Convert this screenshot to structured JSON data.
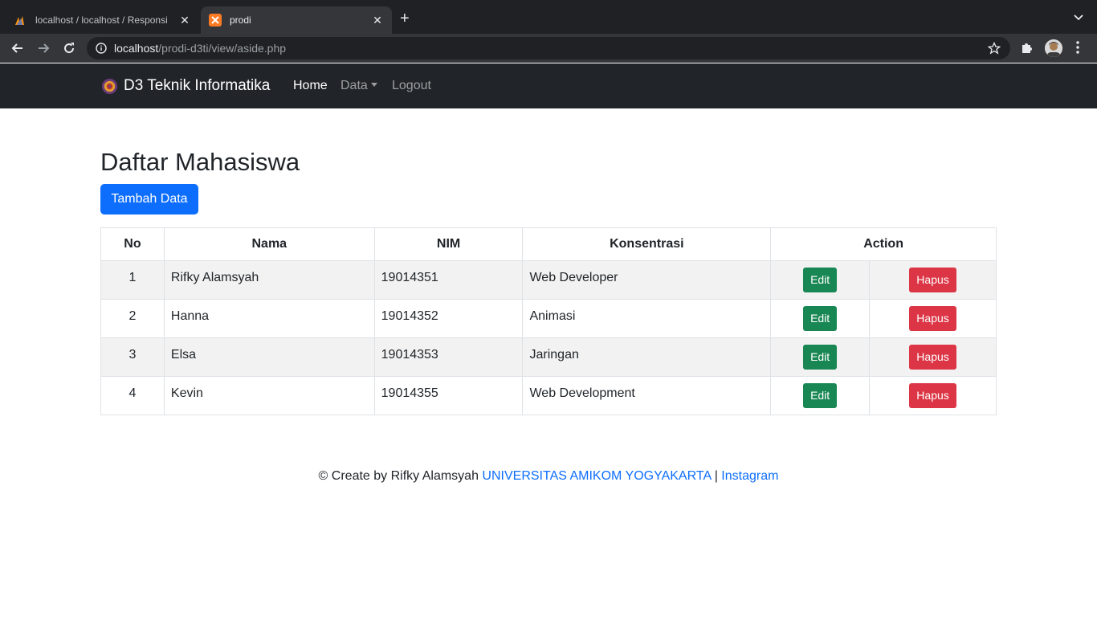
{
  "browser": {
    "tabs": [
      {
        "title": "localhost / localhost / Responsi",
        "active": false
      },
      {
        "title": "prodi",
        "active": true
      }
    ],
    "url_host": "localhost",
    "url_path": "/prodi-d3ti/view/aside.php"
  },
  "navbar": {
    "brand": "D3 Teknik Informatika",
    "links": {
      "home": "Home",
      "data": "Data",
      "logout": "Logout"
    }
  },
  "page": {
    "title": "Daftar Mahasiswa",
    "add_button": "Tambah Data"
  },
  "table": {
    "headers": {
      "no": "No",
      "nama": "Nama",
      "nim": "NIM",
      "konsentrasi": "Konsentrasi",
      "action": "Action"
    },
    "edit_label": "Edit",
    "delete_label": "Hapus",
    "rows": [
      {
        "no": "1",
        "nama": "Rifky Alamsyah",
        "nim": "19014351",
        "konsentrasi": "Web Developer"
      },
      {
        "no": "2",
        "nama": "Hanna",
        "nim": "19014352",
        "konsentrasi": "Animasi"
      },
      {
        "no": "3",
        "nama": "Elsa",
        "nim": "19014353",
        "konsentrasi": "Jaringan"
      },
      {
        "no": "4",
        "nama": "Kevin",
        "nim": "19014355",
        "konsentrasi": "Web Development"
      }
    ]
  },
  "footer": {
    "text": "© Create by Rifky Alamsyah",
    "university": "UNIVERSITAS AMIKOM YOGYAKARTA",
    "separator": "|",
    "instagram": "Instagram"
  },
  "colors": {
    "navbar_bg": "#212529",
    "primary": "#0d6efd",
    "success": "#198754",
    "danger": "#dc3545"
  }
}
